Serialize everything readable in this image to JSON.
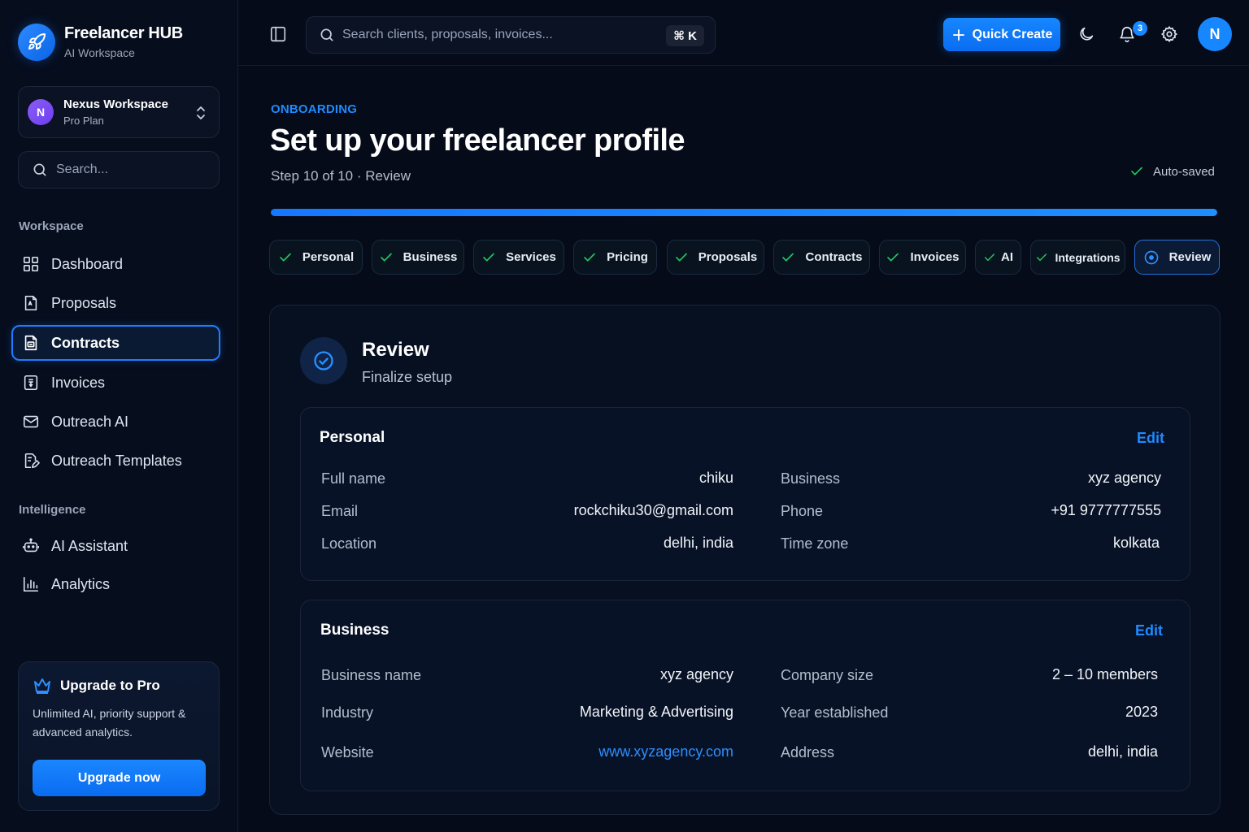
{
  "brand": {
    "title": "Freelancer HUB",
    "subtitle": "AI Workspace"
  },
  "workspace": {
    "avatar": "N",
    "name": "Nexus Workspace",
    "plan": "Pro Plan"
  },
  "sidebar": {
    "search_placeholder": "Search...",
    "sections": [
      {
        "title": "Workspace"
      },
      {
        "title": "Intelligence"
      }
    ],
    "items": [
      {
        "label": "Dashboard",
        "icon": "grid-icon"
      },
      {
        "label": "Proposals",
        "icon": "document-icon"
      },
      {
        "label": "Contracts",
        "icon": "contract-icon",
        "active": true
      },
      {
        "label": "Invoices",
        "icon": "invoice-icon"
      },
      {
        "label": "Outreach AI",
        "icon": "mail-icon"
      },
      {
        "label": "Outreach Templates",
        "icon": "template-icon"
      },
      {
        "label": "AI Assistant",
        "icon": "bot-icon"
      },
      {
        "label": "Analytics",
        "icon": "bar-chart-icon"
      }
    ],
    "upgrade": {
      "title": "Upgrade to Pro",
      "description": "Unlimited AI, priority support & advanced analytics.",
      "button": "Upgrade now"
    }
  },
  "topbar": {
    "search_placeholder": "Search clients, proposals, invoices...",
    "shortcut": "⌘ K",
    "quick_create": "Quick Create",
    "notifications_count": "3",
    "user_avatar": "N"
  },
  "onboarding": {
    "eyebrow": "ONBOARDING",
    "title": "Set up your freelancer profile",
    "step_text": "Step 10 of 10 · Review",
    "autosave": "Auto-saved",
    "progress": 1.0,
    "steps": [
      {
        "label": "Personal",
        "done": true
      },
      {
        "label": "Business",
        "done": true
      },
      {
        "label": "Services",
        "done": true
      },
      {
        "label": "Pricing",
        "done": true
      },
      {
        "label": "Proposals",
        "done": true
      },
      {
        "label": "Contracts",
        "done": true
      },
      {
        "label": "Invoices",
        "done": true
      },
      {
        "label": "AI",
        "done": true
      },
      {
        "label": "Integrations",
        "done": true
      },
      {
        "label": "Review",
        "current": true
      }
    ]
  },
  "review": {
    "title": "Review",
    "subtitle": "Finalize setup",
    "personal": {
      "title": "Personal",
      "edit": "Edit",
      "fields": [
        {
          "label": "Full name",
          "value": "chiku"
        },
        {
          "label": "Business",
          "value": "xyz agency"
        },
        {
          "label": "Email",
          "value": "rockchiku30@gmail.com"
        },
        {
          "label": "Phone",
          "value": "+91 9777777555"
        },
        {
          "label": "Location",
          "value": "delhi, india"
        },
        {
          "label": "Time zone",
          "value": "kolkata"
        }
      ]
    },
    "business": {
      "title": "Business",
      "edit": "Edit",
      "fields": [
        {
          "label": "Business name",
          "value": "xyz agency"
        },
        {
          "label": "Company size",
          "value": "2 – 10 members"
        },
        {
          "label": "Industry",
          "value": "Marketing & Advertising"
        },
        {
          "label": "Year established",
          "value": "2023"
        },
        {
          "label": "Website",
          "value": "www.xyzagency.com"
        },
        {
          "label": "Address",
          "value": "delhi, india"
        }
      ]
    }
  },
  "colors": {
    "accent": "#1787ff",
    "background": "#050b19",
    "success": "#22c55e"
  }
}
